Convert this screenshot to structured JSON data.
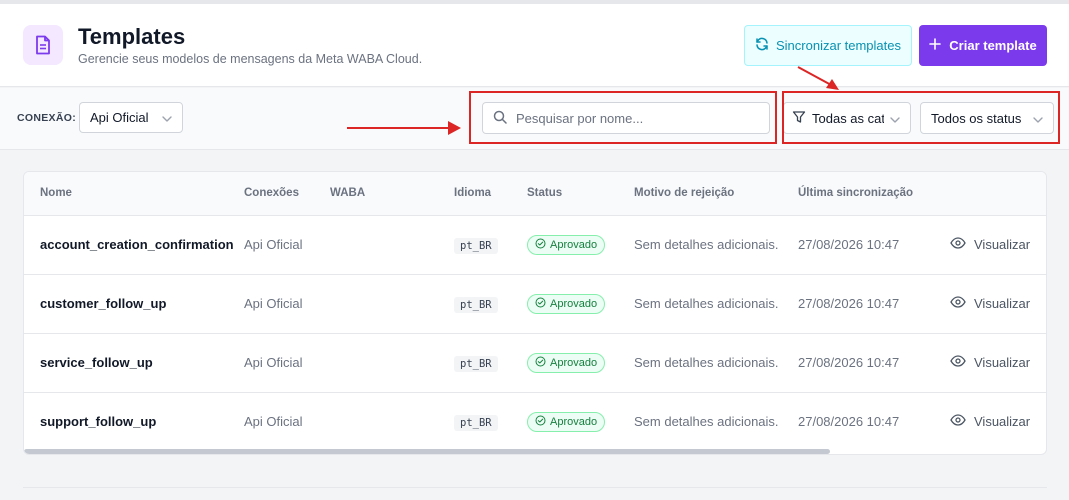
{
  "header": {
    "title": "Templates",
    "subtitle": "Gerencie seus modelos de mensagens da Meta WABA Cloud.",
    "sync_button": "Sincronizar templates",
    "create_button": "Criar template"
  },
  "filters": {
    "connection_label": "CONEXÃO:",
    "connection_value": "Api Oficial",
    "search_placeholder": "Pesquisar por nome...",
    "category_value": "Todas as categorias",
    "status_value": "Todos os status"
  },
  "table": {
    "columns": [
      "Nome",
      "Conexões",
      "WABA",
      "Idioma",
      "Status",
      "Motivo de rejeição",
      "Última sincronização"
    ],
    "rows": [
      {
        "name": "account_creation_confirmation",
        "connection": "Api Oficial",
        "waba": "",
        "language": "pt_BR",
        "status": "Aprovado",
        "reason": "Sem detalhes adicionais.",
        "last_sync": "27/08/2026 10:47",
        "action": "Visualizar"
      },
      {
        "name": "customer_follow_up",
        "connection": "Api Oficial",
        "waba": "",
        "language": "pt_BR",
        "status": "Aprovado",
        "reason": "Sem detalhes adicionais.",
        "last_sync": "27/08/2026 10:47",
        "action": "Visualizar"
      },
      {
        "name": "service_follow_up",
        "connection": "Api Oficial",
        "waba": "",
        "language": "pt_BR",
        "status": "Aprovado",
        "reason": "Sem detalhes adicionais.",
        "last_sync": "27/08/2026 10:47",
        "action": "Visualizar"
      },
      {
        "name": "support_follow_up",
        "connection": "Api Oficial",
        "waba": "",
        "language": "pt_BR",
        "status": "Aprovado",
        "reason": "Sem detalhes adicionais.",
        "last_sync": "27/08/2026 10:47",
        "action": "Visualizar"
      }
    ]
  },
  "colors": {
    "accent": "#7c3aed",
    "sync": "#0891b2",
    "approved": "#15803d",
    "annotation": "#dc2626"
  },
  "icons": {
    "header": "document-icon",
    "sync": "refresh-icon",
    "create": "plus-icon",
    "search": "search-icon",
    "filter": "filter-icon",
    "chevron": "chevron-down-icon",
    "status": "check-circle-icon",
    "view": "eye-icon"
  }
}
